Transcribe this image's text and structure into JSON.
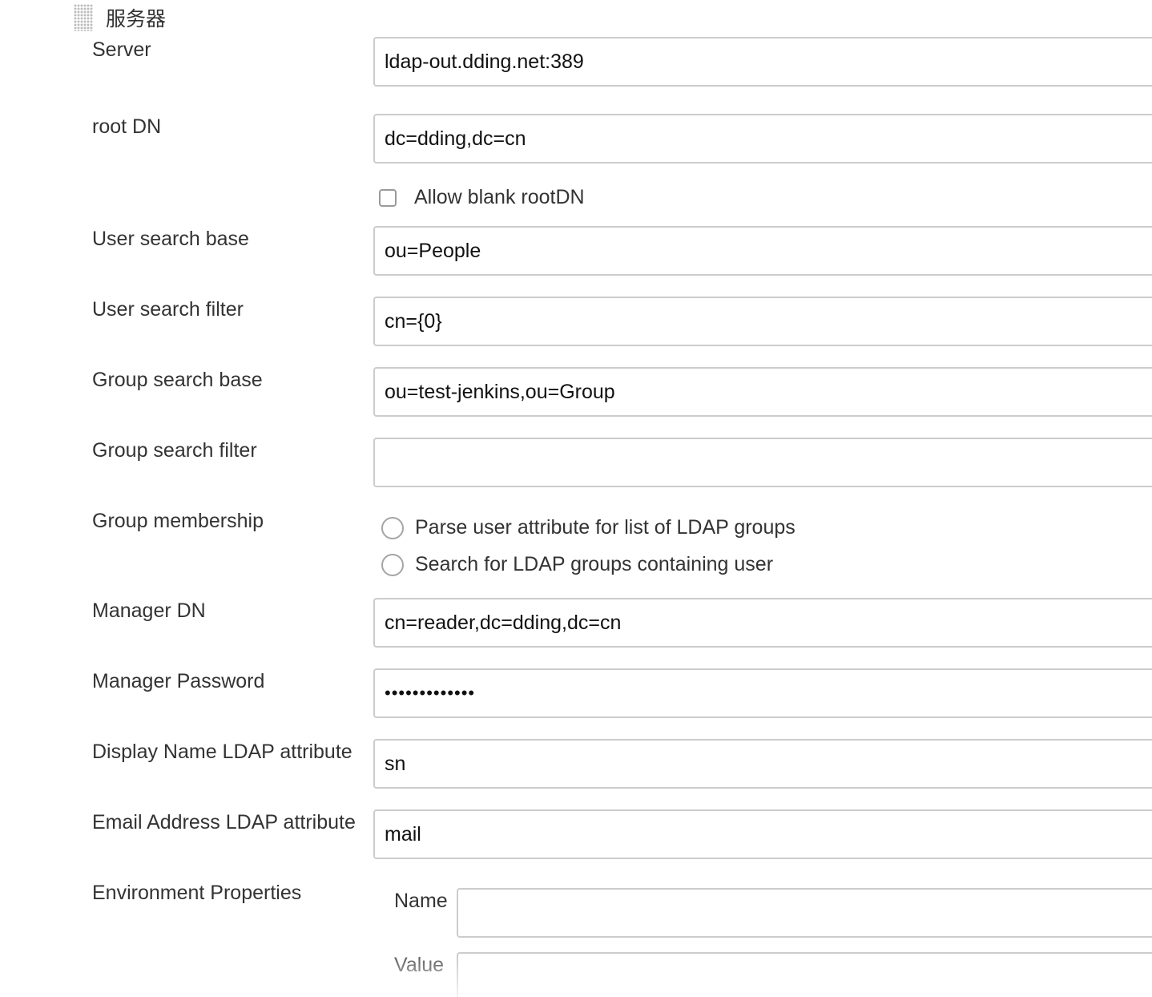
{
  "section": {
    "title": "服务器",
    "grip_icon": "drag-handle-icon"
  },
  "fields": {
    "server": {
      "label": "Server",
      "value": "ldap-out.dding.net:389"
    },
    "root_dn": {
      "label": "root DN",
      "value": "dc=dding,dc=cn"
    },
    "allow_blank_rootdn": {
      "label": "Allow blank rootDN",
      "checked": false
    },
    "user_search_base": {
      "label": "User search base",
      "value": "ou=People"
    },
    "user_search_filter": {
      "label": "User search filter",
      "value": "cn={0}"
    },
    "group_search_base": {
      "label": "Group search base",
      "value": "ou=test-jenkins,ou=Group"
    },
    "group_search_filter": {
      "label": "Group search filter",
      "value": ""
    },
    "group_membership": {
      "label": "Group membership",
      "options": [
        {
          "label": "Parse user attribute for list of LDAP groups",
          "selected": false
        },
        {
          "label": "Search for LDAP groups containing user",
          "selected": false
        }
      ]
    },
    "manager_dn": {
      "label": "Manager DN",
      "value": "cn=reader,dc=dding,dc=cn"
    },
    "manager_password": {
      "label": "Manager Password",
      "value": "•••••••••••••"
    },
    "display_name_attr": {
      "label": "Display Name LDAP attribute",
      "value": "sn"
    },
    "email_attr": {
      "label": "Email Address LDAP attribute",
      "value": "mail"
    },
    "environment_properties": {
      "label": "Environment Properties",
      "name_label": "Name",
      "name_value": "",
      "value_label": "Value",
      "value_value": ""
    }
  }
}
